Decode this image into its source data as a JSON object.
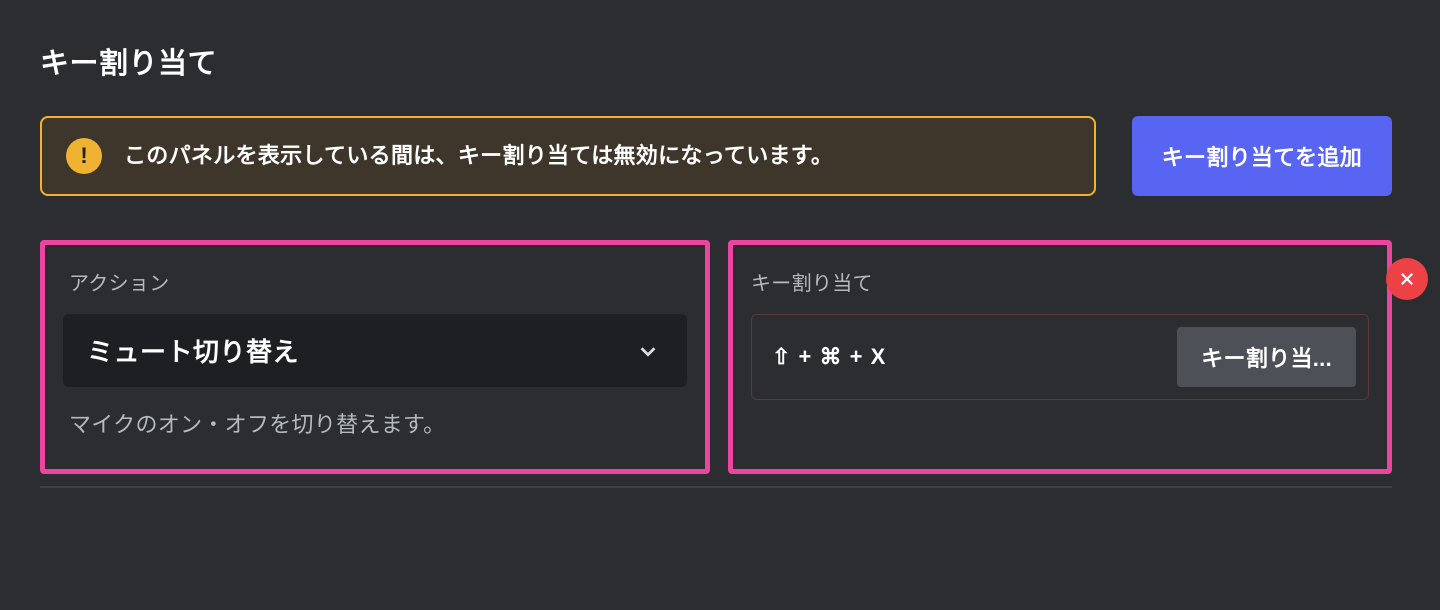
{
  "page": {
    "title": "キー割り当て"
  },
  "warning": {
    "text": "このパネルを表示している間は、キー割り当ては無効になっています。"
  },
  "buttons": {
    "add": "キー割り当てを追加",
    "record": "キー割り当..."
  },
  "action_panel": {
    "label": "アクション",
    "selected": "ミュート切り替え",
    "description": "マイクのオン・オフを切り替えます。"
  },
  "key_panel": {
    "label": "キー割り当て",
    "combo": "⇧ + ⌘ + X"
  }
}
